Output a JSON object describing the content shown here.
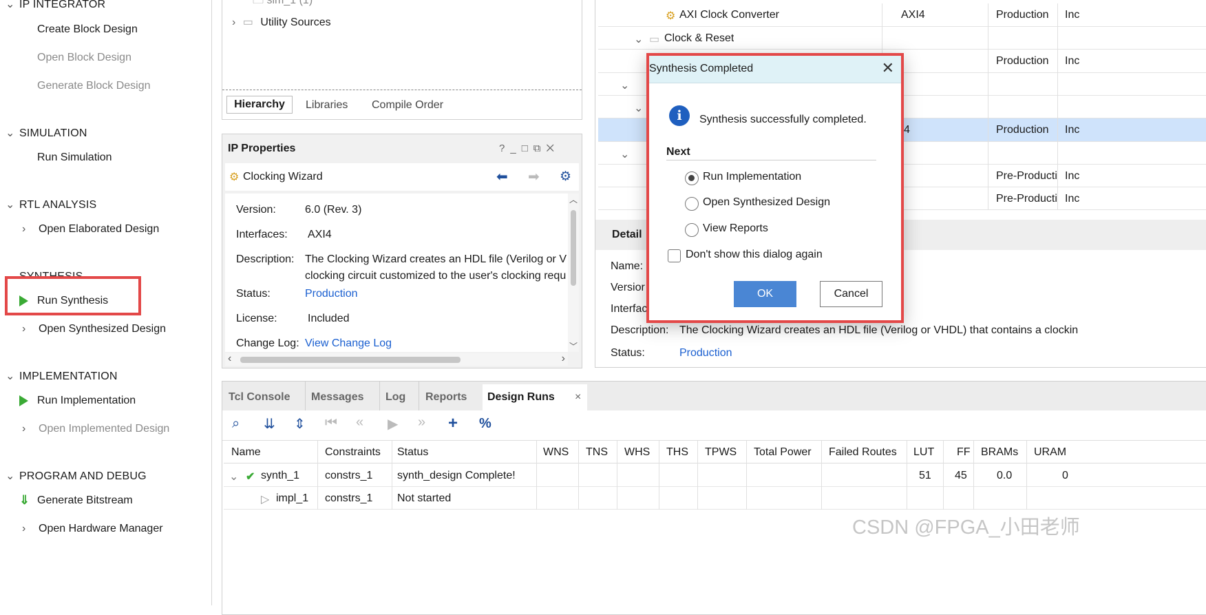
{
  "nav": {
    "ip_integrator": {
      "label": "IP INTEGRATOR",
      "items": [
        "Create Block Design",
        "Open Block Design",
        "Generate Block Design"
      ]
    },
    "simulation": {
      "label": "SIMULATION",
      "items": [
        "Run Simulation"
      ]
    },
    "rtl": {
      "label": "RTL ANALYSIS",
      "items": [
        "Open Elaborated Design"
      ]
    },
    "synthesis": {
      "label": "SYNTHESIS",
      "items": [
        "Run Synthesis",
        "Open Synthesized Design"
      ]
    },
    "implementation": {
      "label": "IMPLEMENTATION",
      "items": [
        "Run Implementation",
        "Open Implemented Design"
      ]
    },
    "program": {
      "label": "PROGRAM AND DEBUG",
      "items": [
        "Generate Bitstream",
        "Open Hardware Manager"
      ]
    }
  },
  "sources": {
    "partial_item": "sim_1 (1)",
    "utility": "Utility Sources",
    "tabs": [
      "Hierarchy",
      "Libraries",
      "Compile Order"
    ]
  },
  "ip_props": {
    "title": "IP Properties",
    "ip_name": "Clocking Wizard",
    "rows": {
      "version_label": "Version:",
      "version": "6.0 (Rev. 3)",
      "interfaces_label": "Interfaces:",
      "interfaces": "AXI4",
      "description_label": "Description:",
      "description_1": "The Clocking Wizard creates an HDL file (Verilog or V",
      "description_2": "clocking circuit customized to the user's clocking requ",
      "status_label": "Status:",
      "status": "Production",
      "license_label": "License:",
      "license": "Included",
      "changelog_label": "Change Log:",
      "changelog": "View Change Log"
    }
  },
  "catalog": {
    "rows": [
      {
        "name": "AXI Clock Converter",
        "iface": "AXI4",
        "status": "Production",
        "lic": "Inc"
      },
      {
        "name": "Clock & Reset",
        "iface": "",
        "status": "",
        "lic": ""
      },
      {
        "name": "",
        "iface": "",
        "status": "Production",
        "lic": "Inc"
      },
      {
        "name": "",
        "iface": "4",
        "status": "Production",
        "lic": "Inc"
      },
      {
        "name": "",
        "iface": "",
        "status": "Pre-Producti",
        "lic": "Inc"
      },
      {
        "name": "",
        "iface": "",
        "status": "Pre-Producti",
        "lic": "Inc"
      }
    ],
    "details": {
      "title": "Detail",
      "name_label": "Name:",
      "version_label": "Versior",
      "interface_label": "Interfac",
      "description_label": "Description:",
      "description": "The Clocking Wizard creates an HDL file (Verilog or VHDL) that contains a clockin",
      "status_label": "Status:",
      "status": "Production"
    }
  },
  "bottom": {
    "tabs": [
      "Tcl Console",
      "Messages",
      "Log",
      "Reports",
      "Design Runs"
    ],
    "close": "×",
    "columns": [
      "Name",
      "Constraints",
      "Status",
      "WNS",
      "TNS",
      "WHS",
      "THS",
      "TPWS",
      "Total Power",
      "Failed Routes",
      "LUT",
      "FF",
      "BRAMs",
      "URAM"
    ],
    "runs": [
      {
        "name": "synth_1",
        "constraints": "constrs_1",
        "status": "synth_design Complete!",
        "lut": "51",
        "ff": "45",
        "brams": "0.0",
        "uram": "0"
      },
      {
        "name": "impl_1",
        "constraints": "constrs_1",
        "status": "Not started",
        "lut": "",
        "ff": "",
        "brams": "",
        "uram": ""
      }
    ]
  },
  "dialog": {
    "title": "Synthesis Completed",
    "message": "Synthesis successfully completed.",
    "next_label": "Next",
    "options": [
      "Run Implementation",
      "Open Synthesized Design",
      "View Reports"
    ],
    "selected": "Run Implementation",
    "dont_show": "Don't show this dialog again",
    "ok": "OK",
    "cancel": "Cancel",
    "info_glyph": "i"
  },
  "watermark": "CSDN @FPGA_小田老师",
  "colors": {
    "accent": "#4a86d4",
    "highlight": "#e34848",
    "run_green": "#3aaa35",
    "selected_row": "#cfe3fb"
  }
}
